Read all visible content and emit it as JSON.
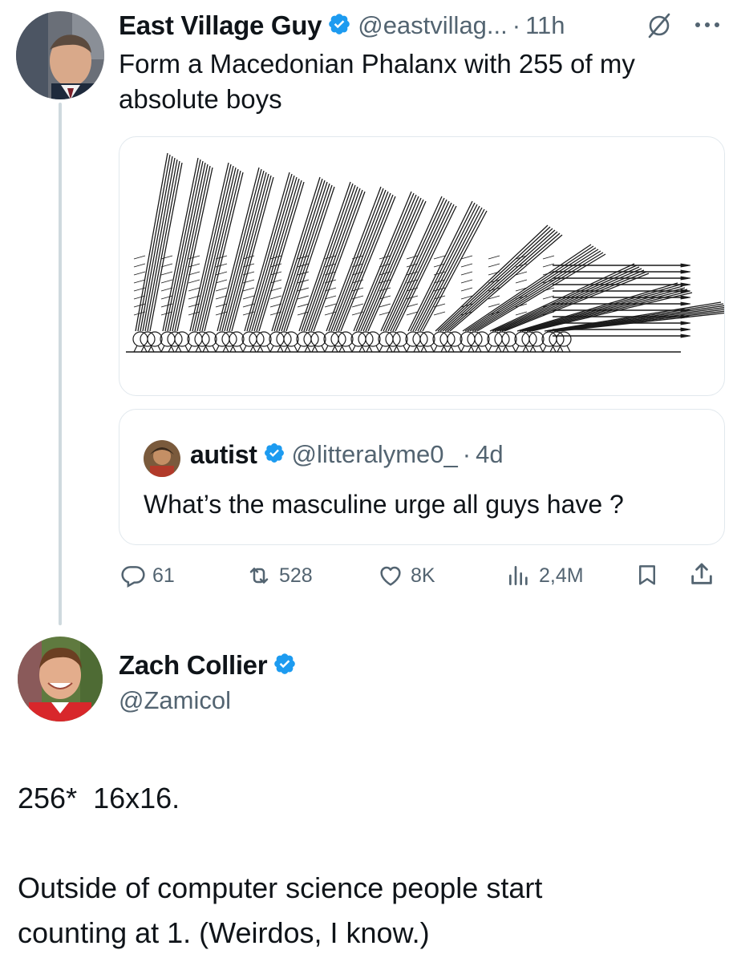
{
  "tweet": {
    "author_name": "East Village Guy",
    "author_handle": "@eastvillag...",
    "separator": "·",
    "time": "11h",
    "text": "Form a Macedonian Phalanx with 255 of my absolute boys",
    "quote": {
      "author_name": "autist",
      "author_handle": "@litteralyme0_",
      "separator": "·",
      "time": "4d",
      "text": "What’s the masculine urge all guys have ?"
    },
    "actions": {
      "replies": "61",
      "retweets": "528",
      "likes": "8K",
      "views": "2,4M"
    }
  },
  "reply": {
    "author_name": "Zach Collier",
    "author_handle": "@Zamicol",
    "text_line1": "256*  16x16.",
    "text_line2": "Outside of computer science people start",
    "text_line3": "counting at 1. (Weirdos, I know.)"
  },
  "colors": {
    "verified": "#1d9bf0",
    "secondary_text": "#536471",
    "thread_line": "#cfd9de"
  },
  "icons": [
    "verified-icon",
    "grok-icon",
    "more-icon",
    "reply-icon",
    "retweet-icon",
    "like-icon",
    "views-icon",
    "bookmark-icon",
    "share-icon"
  ]
}
